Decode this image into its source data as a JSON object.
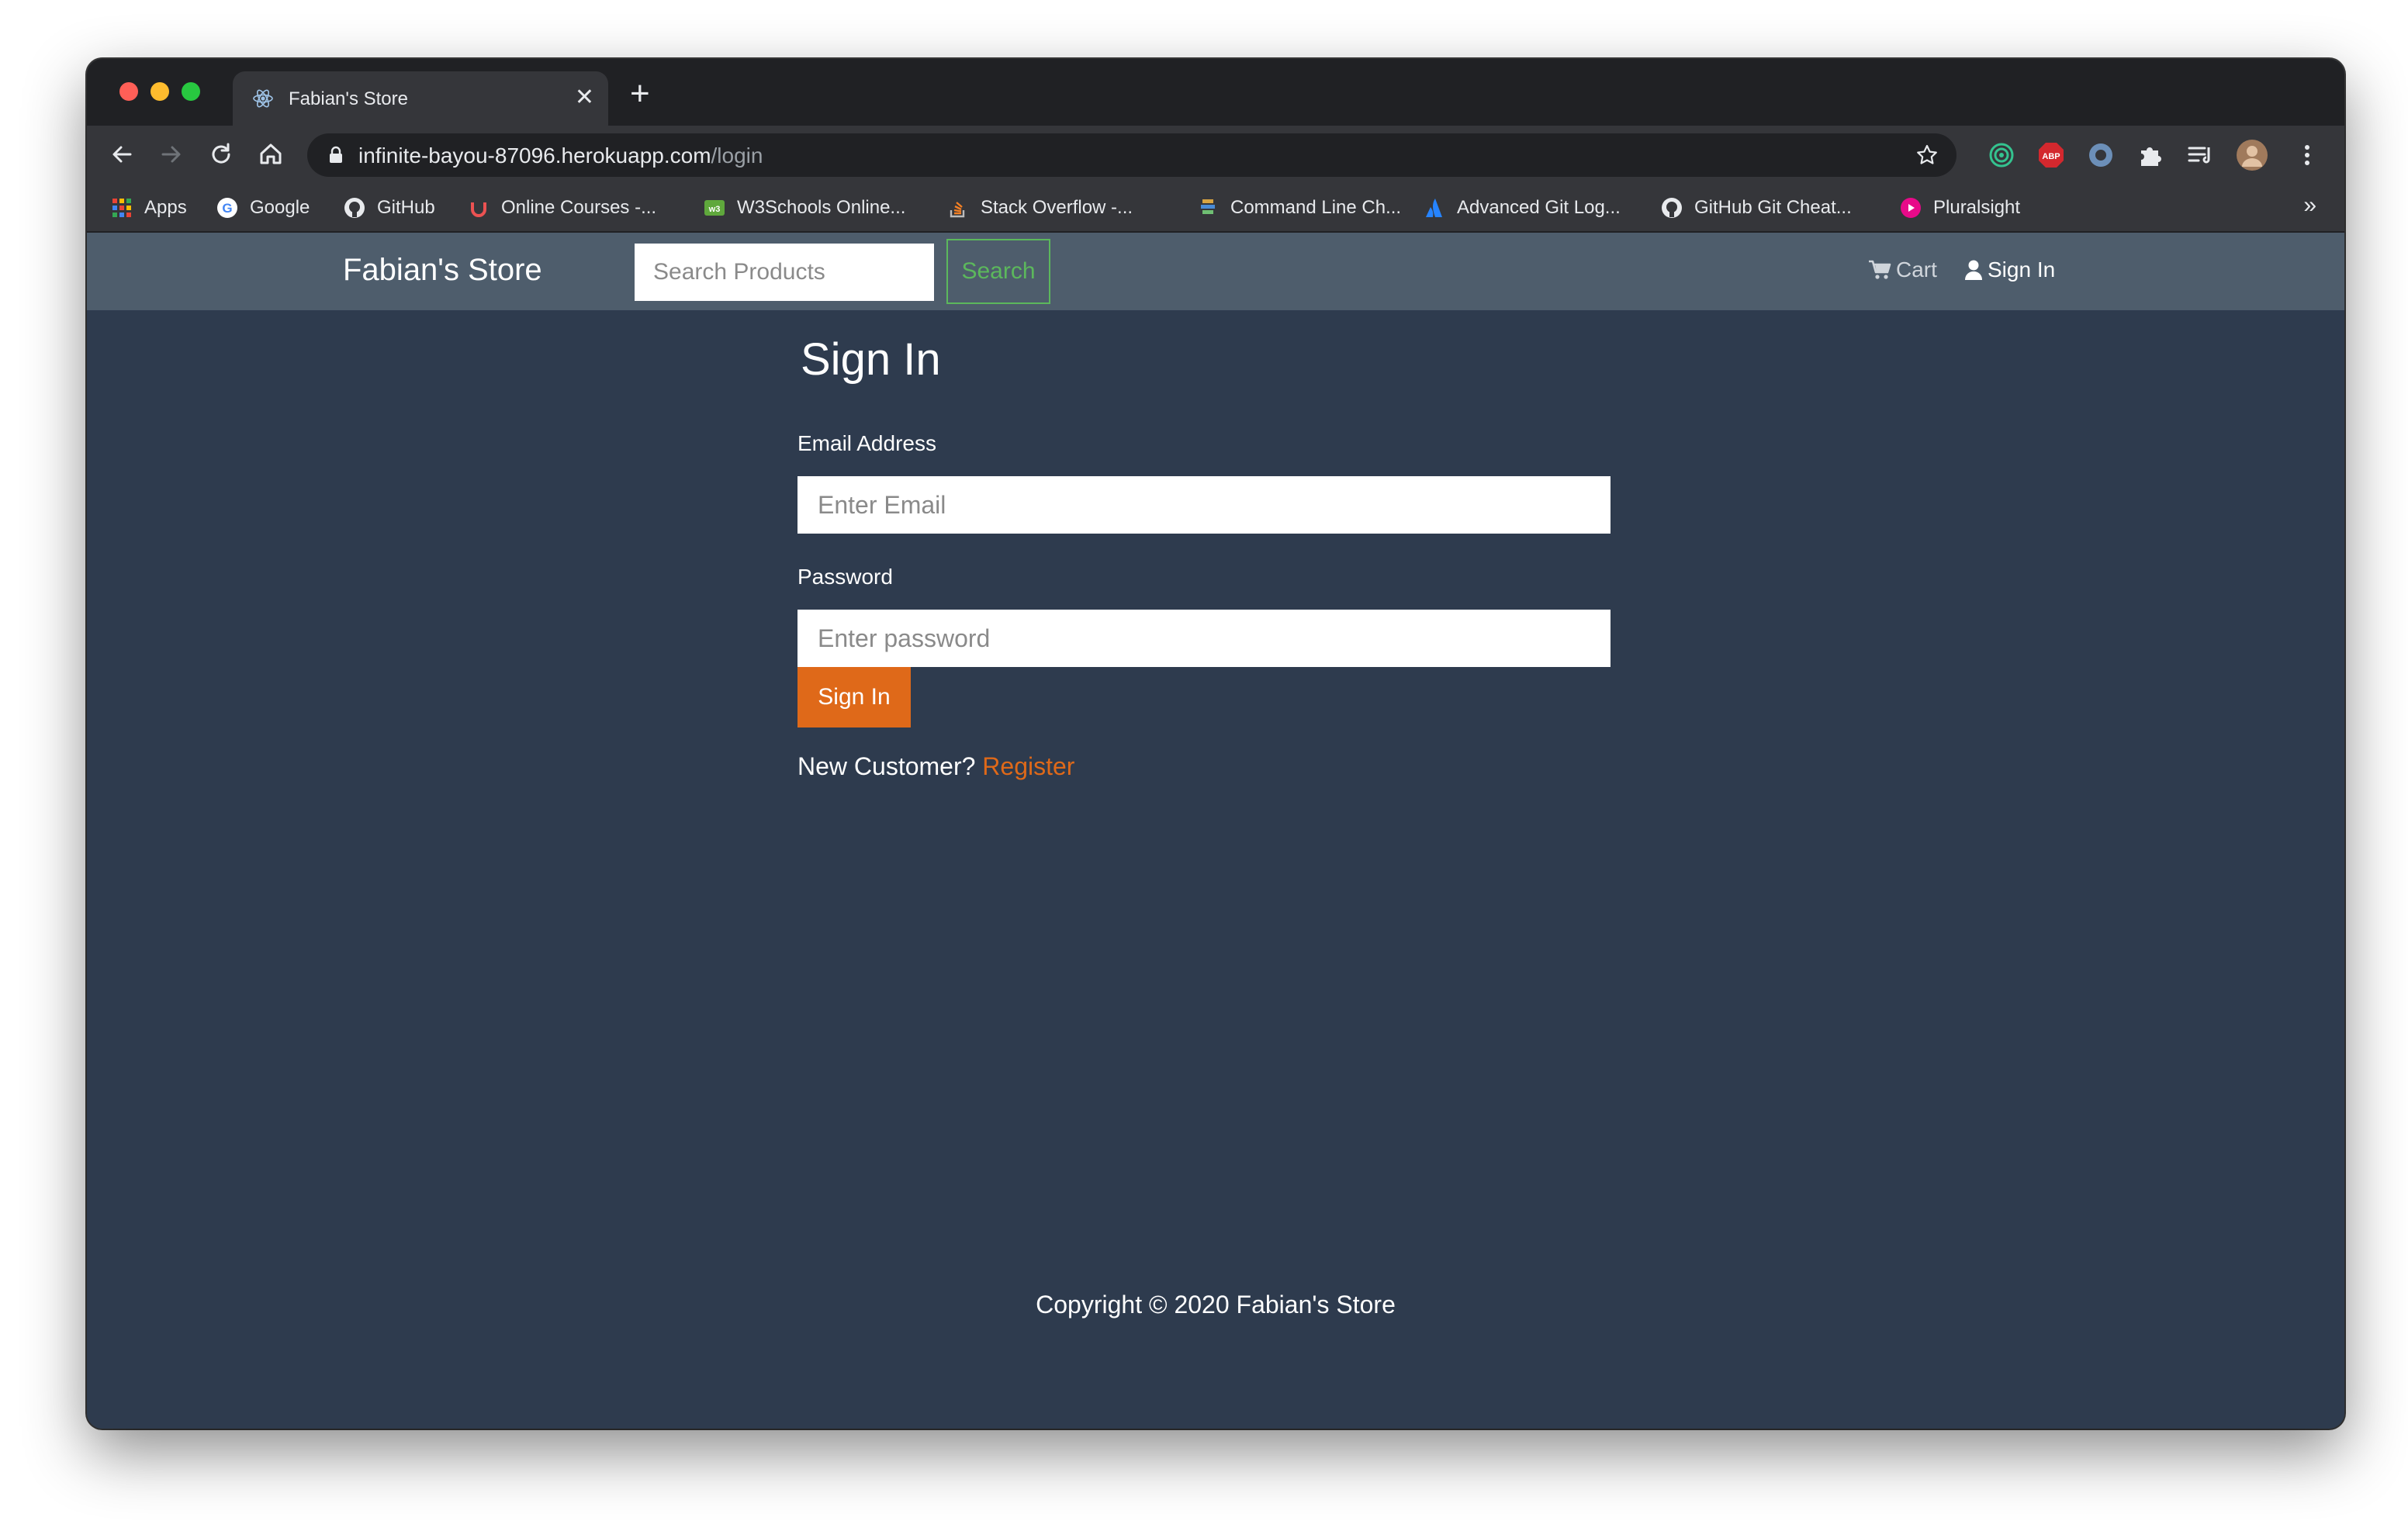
{
  "browser": {
    "tab_title": "Fabian's Store",
    "url_host": "infinite-bayou-87096.herokuapp.com",
    "url_path": "/login",
    "bookmarks": [
      {
        "label": "Apps",
        "icon": "apps-grid-icon"
      },
      {
        "label": "Google",
        "icon": "google-icon"
      },
      {
        "label": "GitHub",
        "icon": "github-icon"
      },
      {
        "label": "Online Courses -...",
        "icon": "udemy-icon"
      },
      {
        "label": "W3Schools Online...",
        "icon": "w3schools-icon"
      },
      {
        "label": "Stack Overflow -...",
        "icon": "stackoverflow-icon"
      },
      {
        "label": "Command Line Ch...",
        "icon": "command-line-icon"
      },
      {
        "label": "Advanced Git Log...",
        "icon": "atlassian-icon"
      },
      {
        "label": "GitHub Git Cheat...",
        "icon": "github-icon"
      },
      {
        "label": "Pluralsight",
        "icon": "pluralsight-icon"
      }
    ],
    "overflow": "»"
  },
  "navbar": {
    "brand": "Fabian's Store",
    "search_placeholder": "Search Products",
    "search_button": "Search",
    "cart_label": "Cart",
    "signin_label": "Sign In"
  },
  "form": {
    "heading": "Sign In",
    "email_label": "Email Address",
    "email_placeholder": "Enter Email",
    "password_label": "Password",
    "password_placeholder": "Enter password",
    "submit_label": "Sign In",
    "new_customer_text": "New Customer?",
    "register_link": "Register"
  },
  "footer": {
    "copyright": "Copyright © 2020 Fabian's Store"
  },
  "colors": {
    "page_bg": "#2e3b4e",
    "navbar_bg": "#4e5d6c",
    "accent_orange": "#df6919",
    "success_green": "#5cb85c"
  }
}
